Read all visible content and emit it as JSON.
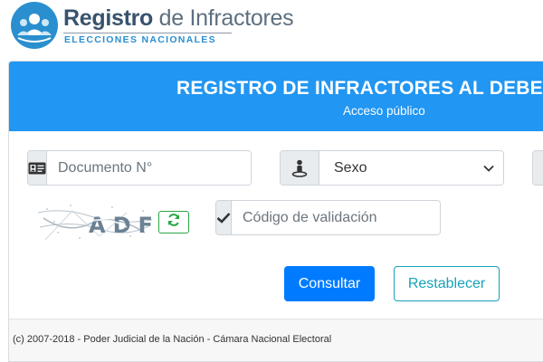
{
  "logo": {
    "title_bold": "Registro",
    "title_light": " de Infractores",
    "subtitle": "ELECCIONES NACIONALES",
    "icon": "people-group-icon"
  },
  "header": {
    "title": "REGISTRO DE INFRACTORES AL DEBER DE V",
    "subtitle": "Acceso público",
    "color": "#2196f3"
  },
  "form": {
    "documento": {
      "placeholder": "Documento N°",
      "value": "",
      "icon": "id-card-icon"
    },
    "sexo": {
      "selected": "Sexo",
      "icon": "person-pin-icon"
    },
    "captcha": {
      "text": "ADF",
      "refresh_icon": "refresh-icon"
    },
    "codigo": {
      "placeholder": "Código de validación",
      "value": "",
      "icon": "checkmark-icon"
    }
  },
  "buttons": {
    "consultar": "Consultar",
    "restablecer": "Restablecer"
  },
  "footer": {
    "text": "(c) 2007-2018 - Poder Judicial de la Nación - Cámara Nacional Electoral"
  },
  "colors": {
    "primary": "#007bff",
    "info": "#17a2b8",
    "success": "#28a745"
  }
}
